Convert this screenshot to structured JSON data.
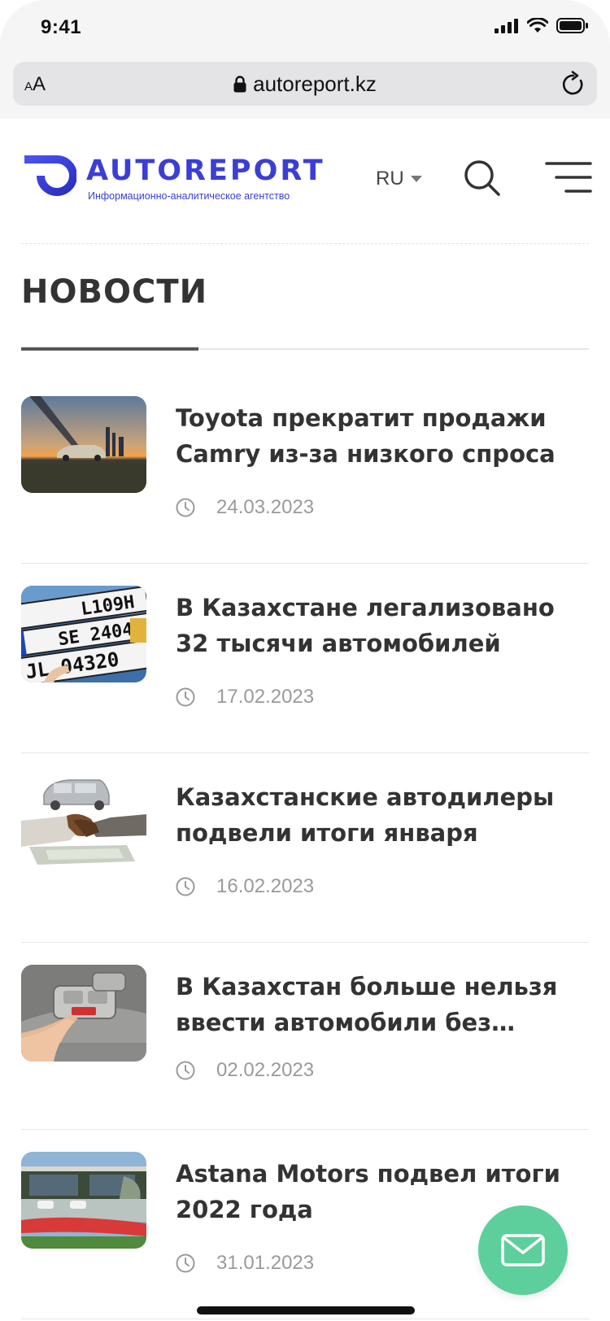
{
  "status_bar": {
    "time": "9:41"
  },
  "browser": {
    "text_size_label_small": "A",
    "text_size_label_large": "A",
    "url": "autoreport.kz"
  },
  "header": {
    "logo_word": "AUTOREPORT",
    "logo_tagline": "Информационно-аналитическое агентство",
    "language": "RU",
    "brand_color": "#3b3ed6"
  },
  "section": {
    "title": "НОВОСТИ"
  },
  "news": [
    {
      "title": "Toyota прекратит продажи Camry из-за низкого спроса",
      "date": "24.03.2023",
      "thumb": "sunset-car"
    },
    {
      "title": "В Казахстане легализовано 32 тысячи автомобилей",
      "date": "17.02.2023",
      "thumb": "license-plates"
    },
    {
      "title": "Казахстанские автодилеры подвели итоги января",
      "date": "16.02.2023",
      "thumb": "handshake-car"
    },
    {
      "title": "В Казахстан больше нельзя ввести автомобили без кнопк...",
      "date": "02.02.2023",
      "thumb": "sos-button"
    },
    {
      "title": "Astana Motors подвел итоги 2022 года",
      "date": "31.01.2023",
      "thumb": "dealership"
    }
  ],
  "fab": {
    "icon": "mail-icon",
    "color": "#5ccf9d"
  }
}
